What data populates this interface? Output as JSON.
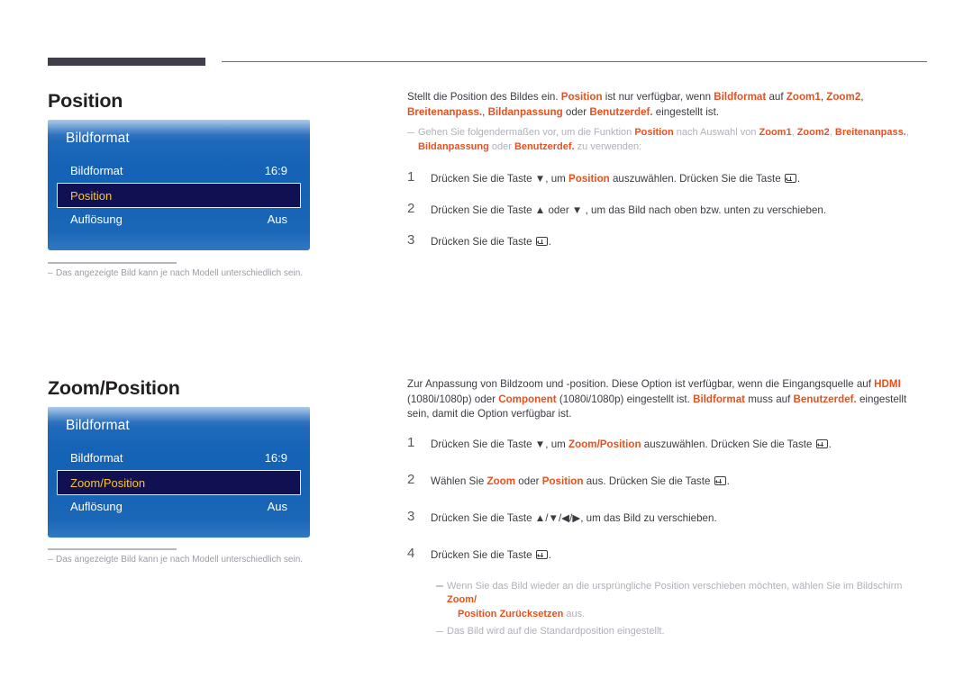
{
  "header": {
    "bar_color": "#413d4b",
    "line_color": "#6b6b72"
  },
  "accent": {
    "orange": "#e8511d",
    "orange_light": "#f09070",
    "menu_blue": "#1463b6",
    "selected_bg": "#111052",
    "selected_text": "#ffc61e"
  },
  "sections": [
    {
      "title": "Position",
      "menu": {
        "heading": "Bildformat",
        "rows": [
          {
            "label": "Bildformat",
            "value": "16:9",
            "selected": false
          },
          {
            "label": "Position",
            "value": "",
            "selected": true
          },
          {
            "label": "Auflösung",
            "value": "Aus",
            "selected": false
          }
        ]
      },
      "caption": "Das angezeigte Bild kann je nach Modell unterschiedlich sein.",
      "intro": {
        "p1_a": "Stellt die Position des Bildes ein. ",
        "p1_b": "Position",
        "p1_c": " ist nur verfügbar, wenn ",
        "p1_d": "Bildformat",
        "p1_e": " auf ",
        "p1_f": "Zoom1",
        "p1_g": ", ",
        "p1_h": "Zoom2",
        "p1_i": ", ",
        "p1_j": "Breitenanpass.",
        "p1_k": ", ",
        "p1_l": "Bildanpassung",
        "p1_m": " oder ",
        "p1_n": "Benutzerdef.",
        "p1_o": " eingestellt ist."
      },
      "note": {
        "a": "Gehen Sie folgendermaßen vor, um die Funktion ",
        "b": "Position",
        "c": " nach Auswahl von ",
        "d": "Zoom1",
        "e": ", ",
        "f": "Zoom2",
        "g": ", ",
        "h": "Breitenanpass.",
        "i": ", ",
        "j": "Bildanpassung",
        "k": " oder ",
        "l": "Benutzerdef.",
        "m": " zu verwenden:"
      },
      "steps": [
        {
          "num": "1",
          "a": "Drücken Sie die Taste ▼, um ",
          "b": "Position",
          "c": " auszuwählen. Drücken Sie die Taste ",
          "d": "."
        },
        {
          "num": "2",
          "a": "Drücken Sie die Taste ▲ oder ▼ , um das Bild nach oben bzw. unten zu verschieben.",
          "b": "",
          "c": "",
          "d": ""
        },
        {
          "num": "3",
          "a": "Drücken Sie die Taste ",
          "b": "",
          "c": "",
          "d": "."
        }
      ]
    },
    {
      "title": "Zoom/Position",
      "menu": {
        "heading": "Bildformat",
        "rows": [
          {
            "label": "Bildformat",
            "value": "16:9",
            "selected": false
          },
          {
            "label": "Zoom/Position",
            "value": "",
            "selected": true
          },
          {
            "label": "Auflösung",
            "value": "Aus",
            "selected": false
          }
        ]
      },
      "caption": "Das angezeigte Bild kann je nach Modell unterschiedlich sein.",
      "intro": {
        "a": "Zur Anpassung von Bildzoom und -position. Diese Option ist verfügbar, wenn die Eingangsquelle auf ",
        "b": "HDMI",
        "c": " (1080i/1080p) oder ",
        "d": "Component",
        "e": " (1080i/1080p) eingestellt ist. ",
        "f": "Bildformat",
        "g": " muss auf ",
        "h": "Benutzerdef.",
        "i": " eingestellt sein, damit die Option verfügbar ist."
      },
      "steps": [
        {
          "num": "1",
          "a": "Drücken Sie die Taste ▼, um ",
          "b": "Zoom/Position",
          "c": " auszuwählen. Drücken Sie die Taste ",
          "d": "."
        },
        {
          "num": "2",
          "a": "Wählen Sie ",
          "b": "Zoom",
          "c": " oder ",
          "b2": "Position",
          "c2": " aus. Drücken Sie die Taste ",
          "d": "."
        },
        {
          "num": "3",
          "a": "Drücken Sie die Taste ▲/▼/◀/▶, um das Bild zu verschieben.",
          "b": "",
          "c": "",
          "d": ""
        },
        {
          "num": "4",
          "a": "Drücken Sie die Taste ",
          "b": "",
          "c": "",
          "d": "."
        }
      ],
      "end_notes": [
        {
          "a": "Wenn Sie das Bild wieder an die ursprüngliche Position verschieben möchten, wählen Sie im Bildschirm ",
          "b": "Zoom/",
          "c": "Position Zurücksetzen",
          "d": " aus."
        },
        {
          "a": "Das Bild wird auf die Standardposition eingestellt.",
          "b": "",
          "c": "",
          "d": ""
        }
      ]
    }
  ]
}
